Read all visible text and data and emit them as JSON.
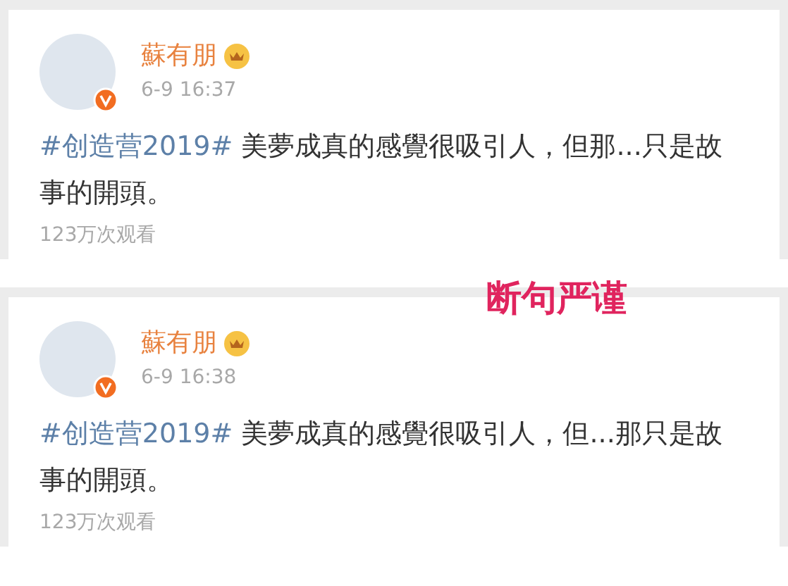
{
  "posts": [
    {
      "author": "蘇有朋",
      "time": "6-9 16:37",
      "hashtag": "#创造营2019#",
      "text": " 美夢成真的感覺很吸引人，但那...只是故事的開頭。",
      "views": "123万次观看"
    },
    {
      "author": "蘇有朋",
      "time": "6-9 16:38",
      "hashtag": "#创造营2019#",
      "text": " 美夢成真的感覺很吸引人，但...那只是故事的開頭。",
      "views": "123万次观看"
    }
  ],
  "annotation": "断句严谨"
}
